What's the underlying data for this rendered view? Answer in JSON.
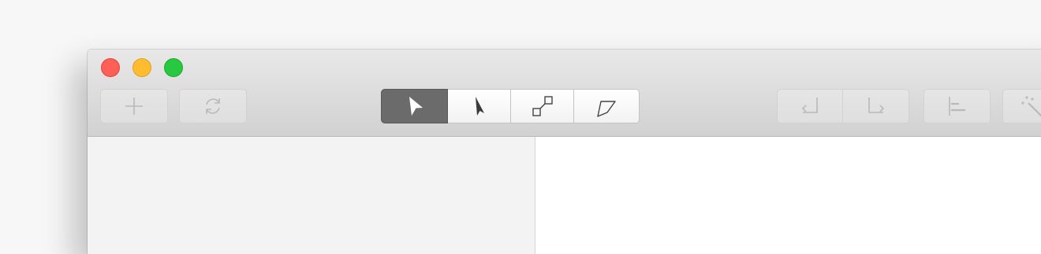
{
  "window": {
    "traffic_lights": [
      {
        "name": "close",
        "color": "#fe5f57"
      },
      {
        "name": "minimize",
        "color": "#febc2e"
      },
      {
        "name": "zoom",
        "color": "#28c840"
      }
    ]
  },
  "toolbar": {
    "left_buttons": [
      {
        "icon": "plus-icon",
        "enabled": false
      },
      {
        "icon": "refresh-icon",
        "enabled": false
      }
    ],
    "tool_segments": [
      {
        "icon": "select-arrow-icon",
        "active": true
      },
      {
        "icon": "direct-select-arrow-icon",
        "active": false
      },
      {
        "icon": "node-squares-icon",
        "active": false
      },
      {
        "icon": "polygon-icon",
        "active": false
      }
    ],
    "history_segments": [
      {
        "icon": "undo-icon",
        "enabled": false
      },
      {
        "icon": "redo-icon",
        "enabled": false
      }
    ],
    "right_buttons": [
      {
        "icon": "align-left-icon",
        "enabled": false
      },
      {
        "icon": "magic-wand-icon",
        "enabled": false
      }
    ]
  },
  "colors": {
    "active_segment": "#6b6b6b",
    "sidebar_bg": "#f3f3f3",
    "content_bg": "#ffffff"
  }
}
